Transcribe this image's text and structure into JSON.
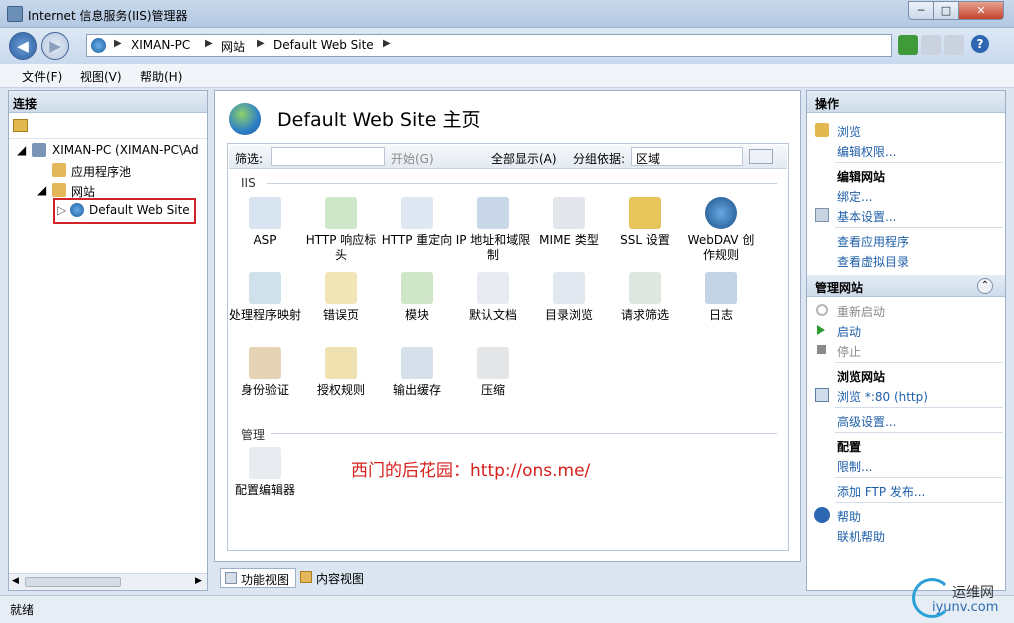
{
  "window": {
    "title": "Internet 信息服务(IIS)管理器",
    "min": "─",
    "max": "□",
    "close": "✕"
  },
  "nav": {
    "back": "◀",
    "forward": "▶",
    "crumbs": [
      "XIMAN-PC",
      "网站",
      "Default Web Site"
    ],
    "sep": "▶",
    "help": "?"
  },
  "menu": [
    "文件(F)",
    "视图(V)",
    "帮助(H)"
  ],
  "left": {
    "header": "连接",
    "tree": [
      {
        "label": "XIMAN-PC (XIMAN-PC\\Ad",
        "expander": "◢"
      },
      {
        "label": "应用程序池"
      },
      {
        "label": "网站",
        "expander": "◢"
      },
      {
        "label": "Default Web Site",
        "expander": "▷",
        "selected": true
      }
    ],
    "scroll_left": "◀",
    "scroll_right": "▶"
  },
  "center": {
    "title": "Default Web Site 主页",
    "filter_label": "筛选:",
    "start_label": "开始(G)",
    "show_all_label": "全部显示(A)",
    "group_by_label": "分组依据:",
    "group_by_value": "区域",
    "groups": [
      {
        "name": "IIS",
        "features": [
          "ASP",
          "HTTP 响应标头",
          "HTTP 重定向",
          "IP 地址和域限制",
          "MIME 类型",
          "SSL 设置",
          "WebDAV 创作规则",
          "处理程序映射",
          "错误页",
          "模块",
          "默认文档",
          "目录浏览",
          "请求筛选",
          "日志",
          "身份验证",
          "授权规则",
          "输出缓存",
          "压缩"
        ]
      },
      {
        "name": "管理",
        "features": [
          "配置编辑器"
        ]
      }
    ],
    "watermark": "西门的后花园：http://ons.me/",
    "tabs": [
      "功能视图",
      "内容视图"
    ]
  },
  "right": {
    "header": "操作",
    "browse": "浏览",
    "edit_perms": "编辑权限...",
    "edit_site": "编辑网站",
    "bindings": "绑定...",
    "basic_settings": "基本设置...",
    "view_apps": "查看应用程序",
    "view_vdirs": "查看虚拟目录",
    "manage_site": "管理网站",
    "collapse": "⌃",
    "restart": "重新启动",
    "start": "启动",
    "stop": "停止",
    "browse_site": "浏览网站",
    "browse_80": "浏览 *:80 (http)",
    "advanced": "高级设置...",
    "config": "配置",
    "limits": "限制...",
    "ftp": "添加 FTP 发布...",
    "help": "帮助",
    "online_help": "联机帮助"
  },
  "status": {
    "text": "就绪",
    "brand": "运维网",
    "brand_url": "iyunv.com"
  }
}
